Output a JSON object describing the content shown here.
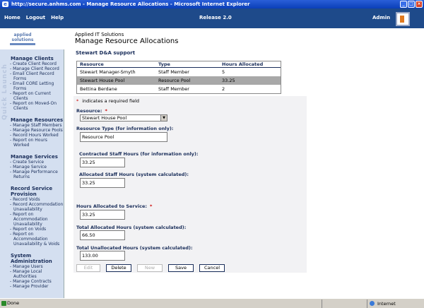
{
  "window": {
    "title": "http://secure.anhms.com - Manage Resource Allocations - Microsoft Internet Explorer"
  },
  "topnav": {
    "links": [
      "Home",
      "Logout",
      "Help"
    ],
    "release": "Release 2.0",
    "user": "Admin"
  },
  "header": {
    "brand_line1": "applied",
    "brand_line2": "solutions",
    "company": "Applied IT Solutions",
    "title": "Manage Resource Allocations"
  },
  "sidebar": {
    "quick_launch": "Quick Launch",
    "sections": [
      {
        "title": "Manage Clients",
        "items": [
          "Create Client Record",
          "Manage Client Record",
          "Email Client Record Forms",
          "Email CORE Letting Forms",
          "Report on Current Clients",
          "Report on Moved-On Clients"
        ]
      },
      {
        "title": "Manage Resources",
        "items": [
          "Manage Staff Members",
          "Manage Resource Pools",
          "Record Hours Worked",
          "Report on Hours Worked"
        ]
      },
      {
        "title": "Manage Services",
        "items": [
          "Create Service",
          "Manage Service",
          "Manage Performance Returns"
        ]
      },
      {
        "title": "Record Service Provision",
        "items": [
          "Record Voids",
          "Record Accommodation Unavailability",
          "Report on Accommodation Unavailability",
          "Report on Voids",
          "Report on Accommodation Unavailability & Voids"
        ]
      },
      {
        "title": "System Administration",
        "items": [
          "Manage Users",
          "Manage Local Authorities",
          "Manage Contracts",
          "Manage Provider"
        ]
      }
    ]
  },
  "panel": {
    "title": "Stewart D&A support",
    "columns": [
      "Resource",
      "Type",
      "Hours Allocated"
    ],
    "rows": [
      [
        "Stewart Manager-Smyth",
        "Staff Member",
        "5"
      ],
      [
        "Stewart House Pool",
        "Resource Pool",
        "33.25"
      ],
      [
        "Bettina Berdane",
        "Staff Member",
        "2"
      ]
    ]
  },
  "form": {
    "required_note": "indicates a required field",
    "resource_label": "Resource:",
    "resource_value": "Stewart House Pool",
    "resource_type_label": "Resource Type (for information only):",
    "resource_type_value": "Resource Pool",
    "contracted_label": "Contracted Staff Hours (for information only):",
    "contracted_value": "33.25",
    "allocated_label": "Allocated Staff Hours (system calculated):",
    "allocated_value": "33.25",
    "hours_service_label": "Hours Allocated to Service:",
    "hours_service_value": "33.25",
    "total_alloc_label": "Total Allocated Hours (system calculated):",
    "total_alloc_value": "66.50",
    "total_unalloc_label": "Total Unallocated Hours (system calculated):",
    "total_unalloc_value": "133.00",
    "buttons": {
      "edit": "Edit",
      "delete": "Delete",
      "new": "New",
      "save": "Save",
      "cancel": "Cancel"
    }
  },
  "status": {
    "done": "Done",
    "zone": "Internet"
  }
}
